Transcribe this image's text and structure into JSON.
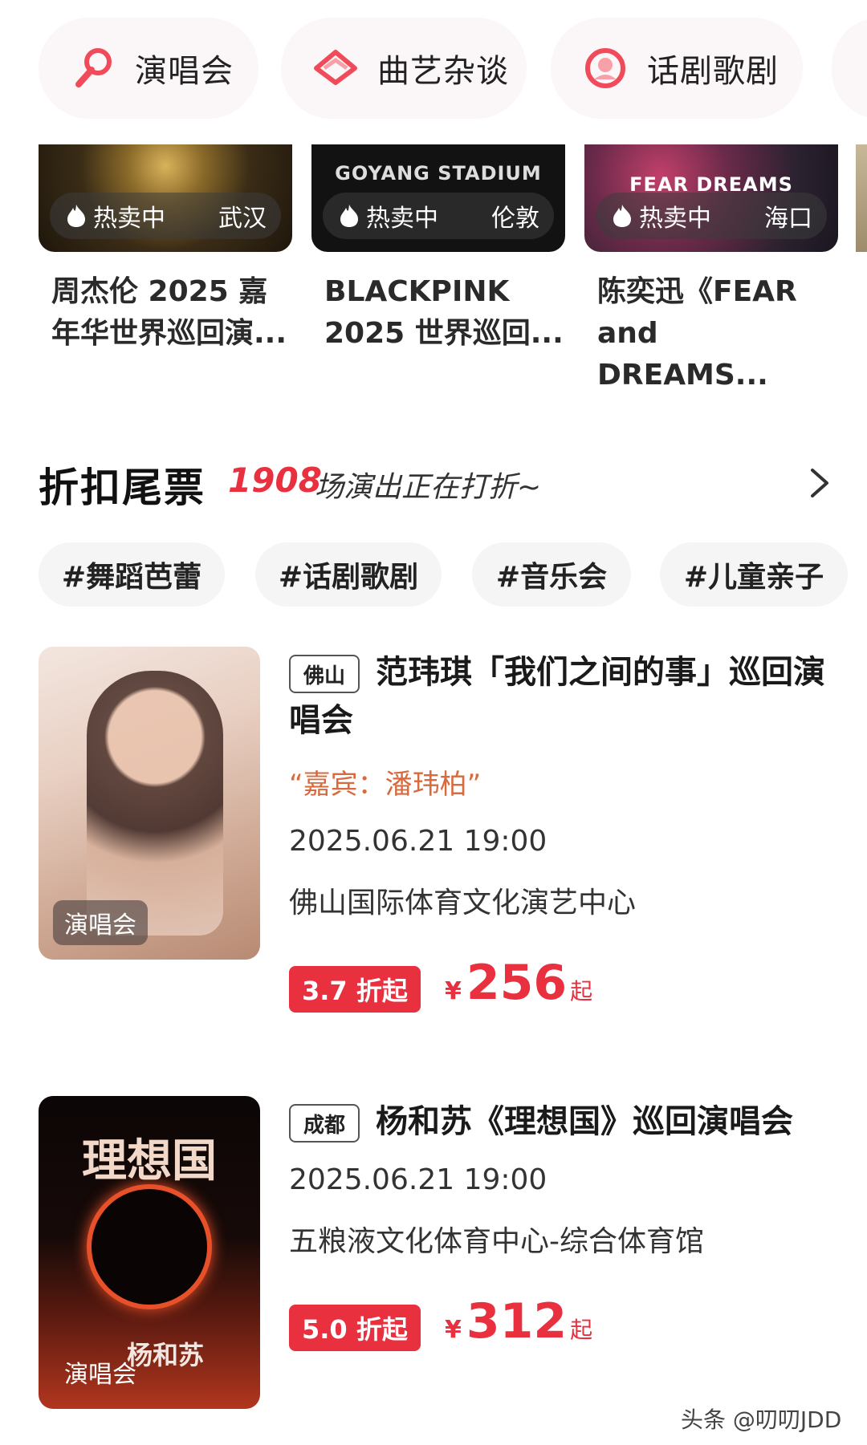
{
  "categories": [
    {
      "label": "演唱会",
      "icon": "microphone-icon"
    },
    {
      "label": "曲艺杂谈",
      "icon": "fan-icon"
    },
    {
      "label": "话剧歌剧",
      "icon": "mask-icon"
    }
  ],
  "hot_cards": [
    {
      "status": "热卖中",
      "city": "武汉",
      "caption": "周杰伦 2025 嘉年华世界巡回演...",
      "poster_text": ""
    },
    {
      "status": "热卖中",
      "city": "伦敦",
      "caption": "BLACKPINK 2025 世界巡回...",
      "poster_text": "GOYANG STADIUM"
    },
    {
      "status": "热卖中",
      "city": "海口",
      "caption": "陈奕迅《FEAR and DREAMS...",
      "poster_text": "FEAR DREAMS"
    }
  ],
  "discount": {
    "title": "折扣尾票",
    "count": "1908",
    "subtitle": "场演出正在打折~"
  },
  "tags": [
    "#舞蹈芭蕾",
    "#话剧歌剧",
    "#音乐会",
    "#儿童亲子"
  ],
  "events": [
    {
      "city": "佛山",
      "title": "范玮琪「我们之间的事」巡回演唱会",
      "guest": "“嘉宾：潘玮柏”",
      "date": "2025.06.21 19:00",
      "venue": "佛山国际体育文化演艺中心",
      "discount": "3.7 折起",
      "currency": "¥",
      "price": "256",
      "price_suffix": "起",
      "badge": "演唱会"
    },
    {
      "city": "成都",
      "title": "杨和苏《理想国》巡回演唱会",
      "date": "2025.06.21 19:00",
      "venue": "五粮液文化体育中心-综合体育馆",
      "discount": "5.0 折起",
      "currency": "¥",
      "price": "312",
      "price_suffix": "起",
      "badge": "演唱会",
      "poster_title": "理想国",
      "poster_artist": "杨和苏"
    }
  ],
  "watermark": "头条 @叨叨JDD",
  "colors": {
    "accent": "#e8303f",
    "guest": "#d76a3e"
  }
}
